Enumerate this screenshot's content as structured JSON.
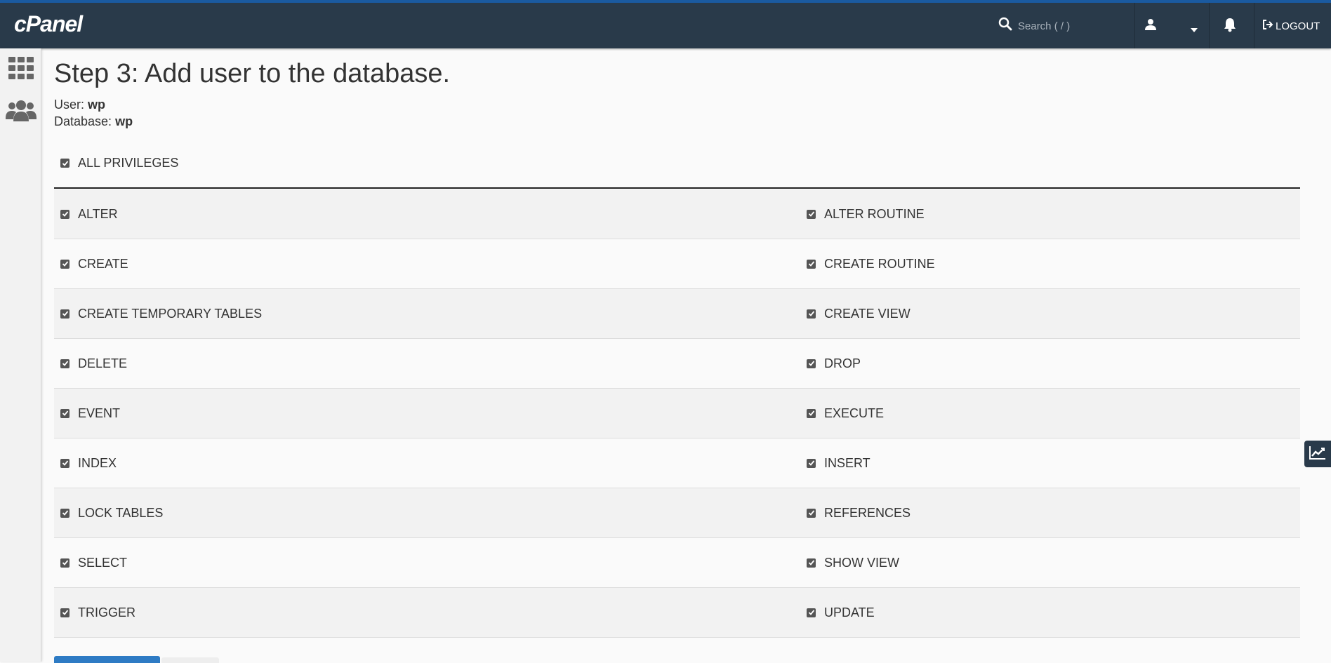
{
  "header": {
    "logo_text": "cPanel",
    "search_placeholder": "Search ( / )",
    "logout_label": "LOGOUT"
  },
  "page": {
    "title": "Step 3: Add user to the database.",
    "user_label": "User:",
    "user_value": "wp",
    "database_label": "Database:",
    "database_value": "wp"
  },
  "privileges": {
    "all_label": "ALL PRIVILEGES",
    "all_checked": true,
    "rows": [
      {
        "left": "ALTER",
        "right": "ALTER ROUTINE"
      },
      {
        "left": "CREATE",
        "right": "CREATE ROUTINE"
      },
      {
        "left": "CREATE TEMPORARY TABLES",
        "right": "CREATE VIEW"
      },
      {
        "left": "DELETE",
        "right": "DROP"
      },
      {
        "left": "EVENT",
        "right": "EXECUTE"
      },
      {
        "left": "INDEX",
        "right": "INSERT"
      },
      {
        "left": "LOCK TABLES",
        "right": "REFERENCES"
      },
      {
        "left": "SELECT",
        "right": "SHOW VIEW"
      },
      {
        "left": "TRIGGER",
        "right": "UPDATE"
      }
    ]
  },
  "icons": {
    "search": "search-icon",
    "user": "user-icon",
    "caret": "chevron-down-icon",
    "bell": "bell-icon",
    "logout": "logout-icon",
    "apps": "grid-icon",
    "users": "users-icon",
    "stats": "chart-line-icon",
    "checkbox": "checkbox-checked-icon"
  },
  "colors": {
    "header_bg": "#293a4a",
    "accent": "#1a5aa0",
    "primary_button": "#2e7bc4"
  }
}
